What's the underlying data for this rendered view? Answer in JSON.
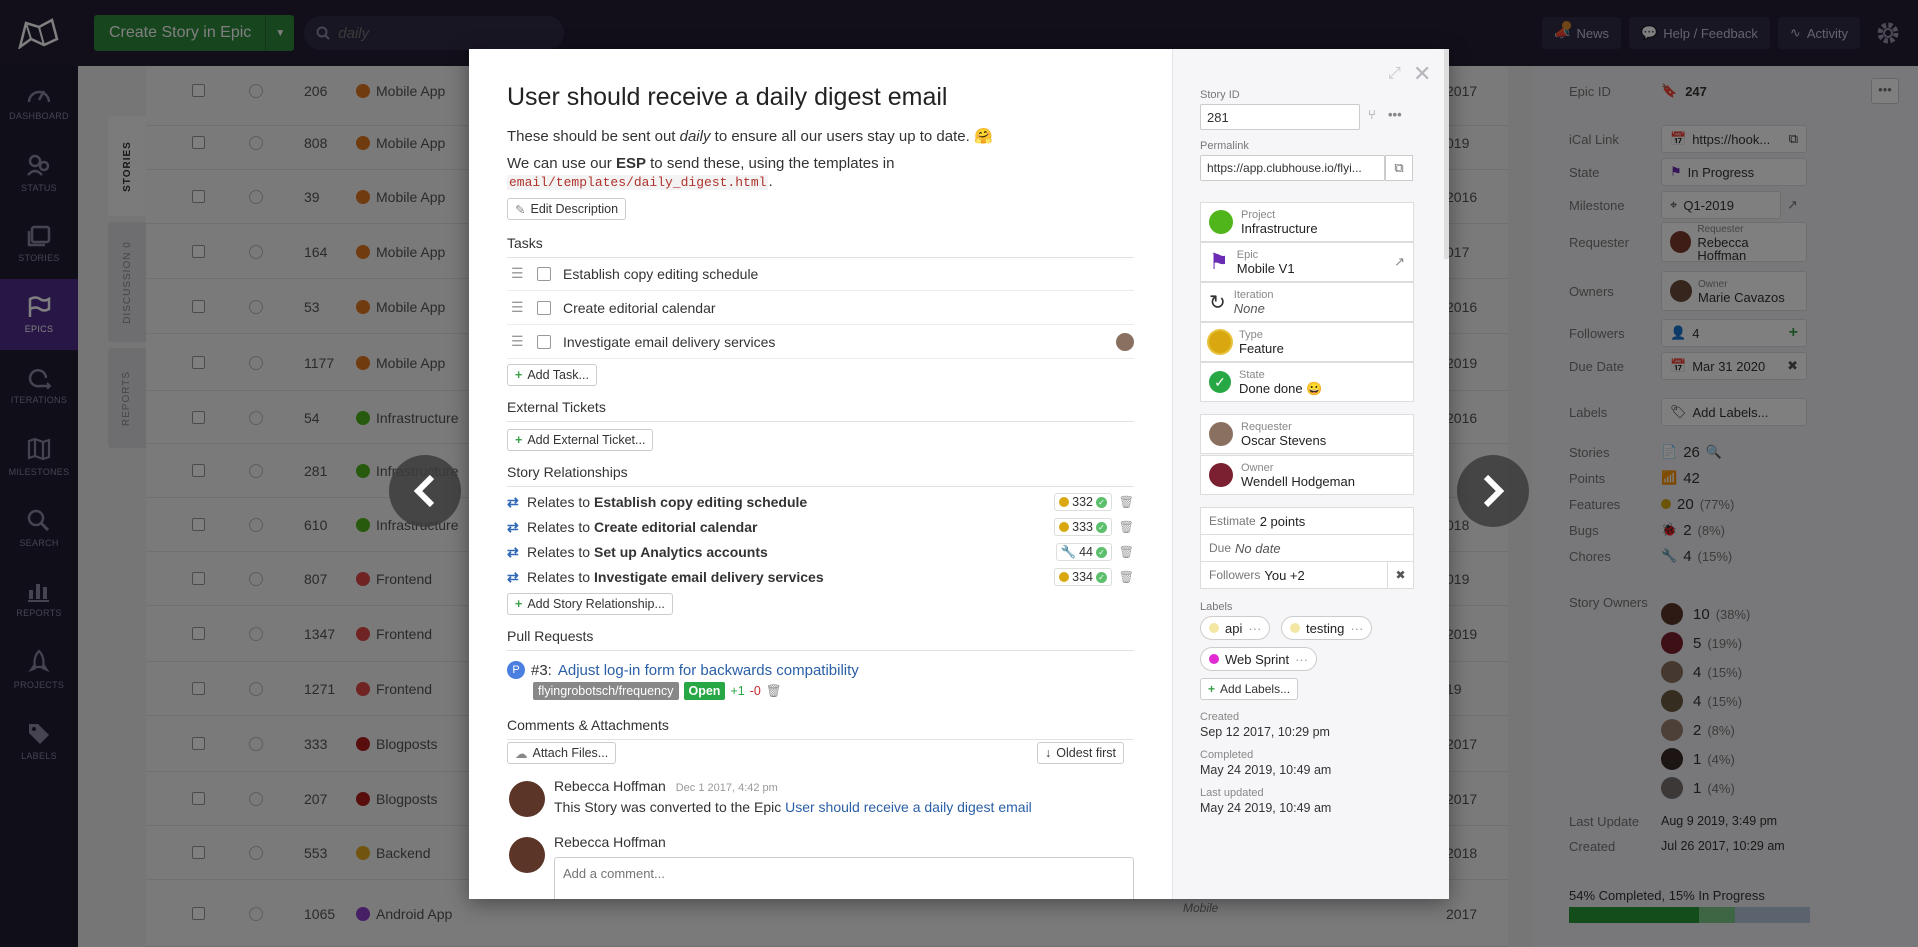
{
  "topbar": {
    "create_label": "Create Story in Epic",
    "search_placeholder": "daily",
    "news_label": "News",
    "help_label": "Help / Feedback",
    "activity_label": "Activity"
  },
  "sidebar": {
    "items": [
      {
        "label": "DASHBOARD",
        "icon": "dashboard-icon"
      },
      {
        "label": "STATUS",
        "icon": "status-icon"
      },
      {
        "label": "STORIES",
        "icon": "stories-icon"
      },
      {
        "label": "EPICS",
        "icon": "flag-icon"
      },
      {
        "label": "ITERATIONS",
        "icon": "iterations-icon"
      },
      {
        "label": "MILESTONES",
        "icon": "map-icon"
      },
      {
        "label": "SEARCH",
        "icon": "search-icon"
      },
      {
        "label": "REPORTS",
        "icon": "bar-chart-icon"
      },
      {
        "label": "PROJECTS",
        "icon": "rocket-icon"
      },
      {
        "label": "LABELS",
        "icon": "tag-icon"
      }
    ]
  },
  "vtabs": {
    "stories": "STORIES",
    "discussion": "DISCUSSION  0",
    "reports": "REPORTS"
  },
  "rows": [
    {
      "id": "206",
      "project": "Mobile App",
      "color": "#e0761f",
      "year": "2017"
    },
    {
      "id": "808",
      "project": "Mobile App",
      "color": "#e0761f",
      "year": "019"
    },
    {
      "id": "39",
      "project": "Mobile App",
      "color": "#e0761f",
      "year": "2016"
    },
    {
      "id": "164",
      "project": "Mobile App",
      "color": "#e0761f",
      "year": "017"
    },
    {
      "id": "53",
      "project": "Mobile App",
      "color": "#e0761f",
      "year": "2016"
    },
    {
      "id": "1177",
      "project": "Mobile App",
      "color": "#e0761f",
      "year": "2019"
    },
    {
      "id": "54",
      "project": "Infrastructure",
      "color": "#4fb51a",
      "year": "2016"
    },
    {
      "id": "281",
      "project": "Infrastructure",
      "color": "#4fb51a",
      "year": ""
    },
    {
      "id": "610",
      "project": "Infrastructure",
      "color": "#4fb51a",
      "year": "018"
    },
    {
      "id": "807",
      "project": "Frontend",
      "color": "#e04747",
      "year": "019"
    },
    {
      "id": "1347",
      "project": "Frontend",
      "color": "#e04747",
      "year": "2019"
    },
    {
      "id": "1271",
      "project": "Frontend",
      "color": "#e04747",
      "year": "19"
    },
    {
      "id": "333",
      "project": "Blogposts",
      "color": "#b31c1c",
      "year": "2017"
    },
    {
      "id": "207",
      "project": "Blogposts",
      "color": "#b31c1c",
      "year": "2017"
    },
    {
      "id": "553",
      "project": "Backend",
      "color": "#e0a81f",
      "year": "2018"
    },
    {
      "id": "1065",
      "project": "Android App",
      "color": "#8e3fc9",
      "year": "2017"
    }
  ],
  "row_tail_text": "Mobile",
  "epic_panel": {
    "epic_id_label": "Epic ID",
    "epic_id": "247",
    "ical_label": "iCal Link",
    "ical_value": "https://hook...",
    "state_label": "State",
    "state_value": "In Progress",
    "milestone_label": "Milestone",
    "milestone_value": "Q1-2019",
    "requester_label": "Requester",
    "requester_small": "Requester",
    "requester_value": "Rebecca Hoffman",
    "owners_label": "Owners",
    "owner_small": "Owner",
    "owner_value": "Marie Cavazos",
    "followers_label": "Followers",
    "followers_value": "4",
    "due_label": "Due Date",
    "due_value": "Mar 31 2020",
    "labels_label": "Labels",
    "labels_value": "Add Labels...",
    "stories_label": "Stories",
    "stories_value": "26",
    "points_label": "Points",
    "points_value": "42",
    "features_label": "Features",
    "features_value": "20",
    "features_pct": "(77%)",
    "bugs_label": "Bugs",
    "bugs_value": "2",
    "bugs_pct": "(8%)",
    "chores_label": "Chores",
    "chores_value": "4",
    "chores_pct": "(15%)",
    "owners_title": "Story Owners",
    "story_owners": [
      {
        "n": "10",
        "p": "(38%)"
      },
      {
        "n": "5",
        "p": "(19%)"
      },
      {
        "n": "4",
        "p": "(15%)"
      },
      {
        "n": "4",
        "p": "(15%)"
      },
      {
        "n": "2",
        "p": "(8%)"
      },
      {
        "n": "1",
        "p": "(4%)"
      },
      {
        "n": "1",
        "p": "(4%)"
      }
    ],
    "last_update_label": "Last Update",
    "last_update_value": "Aug 9 2019, 3:49 pm",
    "created_label": "Created",
    "created_value": "Jul 26 2017, 10:29 am",
    "progress_text": "54% Completed, 15% In Progress",
    "progress": {
      "completed": 0.54,
      "in_progress": 0.15
    }
  },
  "story": {
    "title": "User should receive a daily digest email",
    "desc1_pre": "These should be sent out ",
    "desc1_em": "daily",
    "desc1_post": " to ensure all our users stay up to date.",
    "desc1_emoji": "🤗",
    "desc2_pre": "We can use our ",
    "desc2_bold": "ESP",
    "desc2_post": " to send these, using the templates in",
    "desc2_code": "email/templates/daily_digest.html",
    "desc2_end": ".",
    "edit_desc": "Edit Description",
    "tasks_title": "Tasks",
    "tasks": [
      "Establish copy editing schedule",
      "Create editorial calendar",
      "Investigate email delivery services"
    ],
    "add_task": "Add Task...",
    "ext_title": "External Tickets",
    "add_ext": "Add External Ticket...",
    "rel_title": "Story Relationships",
    "relations": [
      {
        "pre": "Relates to",
        "name": "Establish copy editing schedule",
        "id": "332",
        "kind": "feature"
      },
      {
        "pre": "Relates to",
        "name": "Create editorial calendar",
        "id": "333",
        "kind": "feature"
      },
      {
        "pre": "Relates to",
        "name": "Set up Analytics accounts",
        "id": "44",
        "kind": "chore"
      },
      {
        "pre": "Relates to",
        "name": "Investigate email delivery services",
        "id": "334",
        "kind": "feature"
      }
    ],
    "add_rel": "Add Story Relationship...",
    "pr_title": "Pull Requests",
    "pr_num": "#3:",
    "pr_name": "Adjust log-in form for backwards compatibility",
    "pr_branch": "flyingrobotsch/frequency",
    "pr_status": "Open",
    "pr_add": "+1",
    "pr_del": "-0",
    "comments_title": "Comments & Attachments",
    "attach": "Attach Files...",
    "sort": "Oldest first",
    "comment_author": "Rebecca Hoffman",
    "comment_date": "Dec 1 2017, 4:42 pm",
    "comment_text": "This Story was converted to the Epic ",
    "comment_link": "User should receive a daily digest email",
    "new_author": "Rebecca Hoffman",
    "comment_placeholder": "Add a comment..."
  },
  "side": {
    "id_label": "Story ID",
    "id_value": "281",
    "permalink_label": "Permalink",
    "permalink_value": "https://app.clubhouse.io/flyi...",
    "project_label": "Project",
    "project_value": "Infrastructure",
    "epic_label": "Epic",
    "epic_value": "Mobile V1",
    "iteration_label": "Iteration",
    "iteration_value": "None",
    "type_label": "Type",
    "type_value": "Feature",
    "state_label": "State",
    "state_value": "Done done 😀",
    "requester_label": "Requester",
    "requester_value": "Oscar Stevens",
    "owner_label": "Owner",
    "owner_value": "Wendell Hodgeman",
    "estimate_label": "Estimate",
    "estimate_value": "2 points",
    "due_label": "Due",
    "due_value": "No date",
    "followers_label": "Followers",
    "followers_value": "You +2",
    "labels_title": "Labels",
    "labels": [
      {
        "name": "api",
        "color": "#f3e7a3"
      },
      {
        "name": "testing",
        "color": "#f3e7a3"
      },
      {
        "name": "Web Sprint",
        "color": "#e22ad3"
      }
    ],
    "add_labels": "Add Labels...",
    "created_label": "Created",
    "created_value": "Sep 12 2017, 10:29 pm",
    "completed_label": "Completed",
    "completed_value": "May 24 2019, 10:49 am",
    "updated_label": "Last updated",
    "updated_value": "May 24 2019, 10:49 am"
  },
  "colors": {
    "accent": "#4f2d8c",
    "green": "#2e8a3a",
    "topbar": "#241f35"
  }
}
